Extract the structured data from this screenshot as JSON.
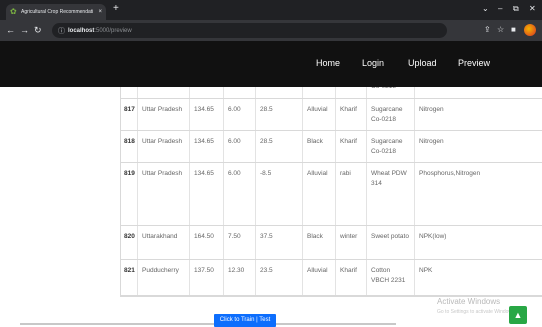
{
  "browser": {
    "tab_title": "Agricultural Crop Recommendati",
    "tab_close": "×",
    "new_tab": "+",
    "url_host": "localhost",
    "url_path": ":5000/preview",
    "window_controls": {
      "minimize": "–",
      "restore": "⧉",
      "close": "✕",
      "tabs_menu": "⌄"
    }
  },
  "nav": {
    "items": [
      "Home",
      "Login",
      "Upload",
      "Preview"
    ]
  },
  "table": {
    "rows": [
      {
        "id": "",
        "state": "",
        "n": "",
        "p": "",
        "temp": "",
        "soil": "",
        "season": "",
        "crop": "Co-0218",
        "fertilizer": ""
      },
      {
        "id": "817",
        "state": "Uttar Pradesh",
        "n": "134.65",
        "p": "6.00",
        "temp": "28.5",
        "soil": "Alluvial",
        "season": "Kharif",
        "crop": "Sugarcane Co-0218",
        "fertilizer": "Nitrogen"
      },
      {
        "id": "818",
        "state": "Uttar Pradesh",
        "n": "134.65",
        "p": "6.00",
        "temp": "28.5",
        "soil": "Black",
        "season": "Kharif",
        "crop": "Sugarcane Co-0218",
        "fertilizer": "Nitrogen"
      },
      {
        "id": "819",
        "state": "Uttar Pradesh",
        "n": "134.65",
        "p": "6.00",
        "temp": "-8.5",
        "soil": "Alluvial",
        "season": "rabi",
        "crop": "Wheat PDW 314",
        "fertilizer": "Phosphorus,Nitrogen"
      },
      {
        "id": "820",
        "state": "Uttarakhand",
        "n": "164.50",
        "p": "7.50",
        "temp": "37.5",
        "soil": "Black",
        "season": "winter",
        "crop": "Sweet potato",
        "fertilizer": "NPK(low)"
      },
      {
        "id": "821",
        "state": "Pudducherry",
        "n": "137.50",
        "p": "12.30",
        "temp": "23.5",
        "soil": "Alluvial",
        "season": "Kharif",
        "crop": "Cotton VBCH 2231",
        "fertilizer": "NPK"
      }
    ]
  },
  "actions": {
    "train_test": "Click to Train | Test"
  },
  "watermark": {
    "title": "Activate Windows",
    "subtitle": "Go to Settings to activate Windows."
  },
  "icons": {
    "favicon": "leaf-icon",
    "back": "back-arrow-icon",
    "forward": "forward-arrow-icon",
    "reload": "reload-icon",
    "info": "info-icon",
    "share": "share-icon",
    "star": "star-icon",
    "extensions": "puzzle-icon",
    "profile": "profile-avatar-icon",
    "scroll_up": "arrow-up-icon"
  },
  "colors": {
    "nav_bg": "#111111",
    "button": "#0d6efd",
    "up_button": "#28a745"
  }
}
